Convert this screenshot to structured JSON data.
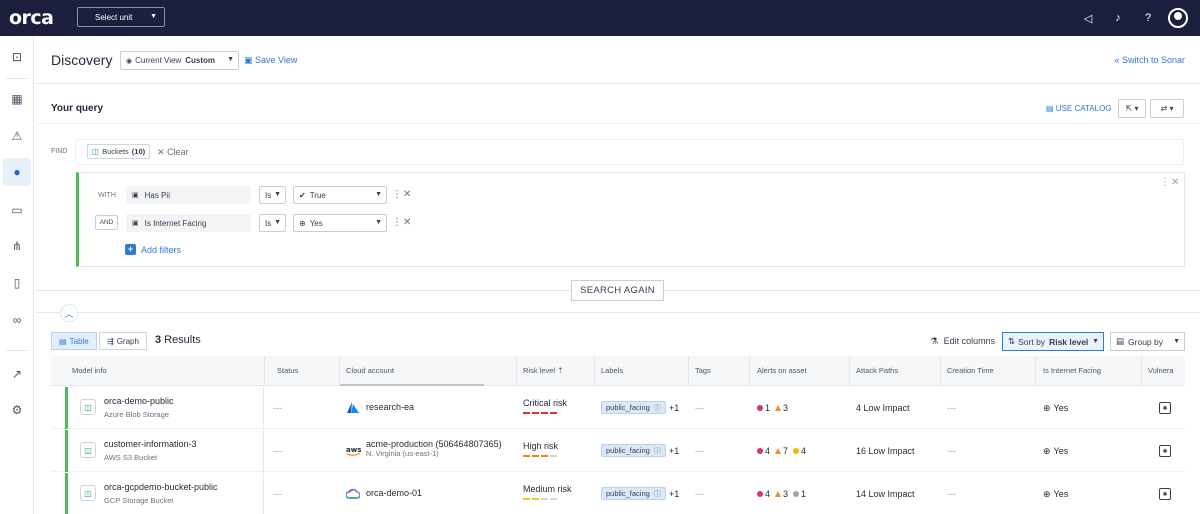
{
  "app": {
    "logo": "orca"
  },
  "topbar": {
    "unit_select": "Select unit"
  },
  "header": {
    "title": "Discovery",
    "view_label": "Current View",
    "view_value": "Custom",
    "save_view": "Save View",
    "switch_sonar": "Switch to Sonar"
  },
  "query": {
    "title": "Your query",
    "use_catalog": "USE CATALOG",
    "find_label": "FIND",
    "chip_label": "Buckets",
    "chip_count": "(10)",
    "clear": "Clear",
    "filters": [
      {
        "op": "WITH",
        "field": "Has Pii",
        "comparator": "Is",
        "value": "True",
        "value_icon": "check-icon"
      },
      {
        "op": "AND",
        "field": "Is Internet Facing",
        "comparator": "Is",
        "value": "Yes",
        "value_icon": "globe-icon"
      }
    ],
    "add_filters": "Add filters",
    "search_again": "SEARCH AGAIN"
  },
  "results": {
    "tabs": [
      {
        "label": "Table",
        "active": true
      },
      {
        "label": "Graph",
        "active": false
      }
    ],
    "count": "3",
    "count_label": "Results",
    "edit_columns": "Edit columns",
    "sort_by_label": "Sort by",
    "sort_by_value": "Risk level",
    "group_by": "Group by"
  },
  "table": {
    "columns": [
      "Model info",
      "Status",
      "Cloud account",
      "Risk level",
      "Labels",
      "Tags",
      "Alerts on asset",
      "Attack Paths",
      "Creation Time",
      "Is Internet Facing",
      "Vulnera"
    ],
    "rows": [
      {
        "name": "orca-demo-public",
        "type": "Azure Blob Storage",
        "status": "---",
        "cloud_icon": "azure-icon",
        "account": "research-ea",
        "region": "",
        "risk": "Critical risk",
        "risk_color": "#e03131",
        "risk_level": 4,
        "label": "public_facing",
        "label_more": "+1",
        "tags": "---",
        "alerts": [
          {
            "shape": "dot",
            "color": "#d6336c",
            "count": "1"
          },
          {
            "shape": "tri",
            "color": "#f28c28",
            "count": "3"
          }
        ],
        "attack_paths": "4 Low Impact",
        "creation": "---",
        "internet": "Yes"
      },
      {
        "name": "customer-information-3",
        "type": "AWS S3 Bucket",
        "status": "---",
        "cloud_icon": "aws-icon",
        "account": "acme-production (506464807365)",
        "region": "N. Virginia (us-east-1)",
        "risk": "High risk",
        "risk_color": "#f08c00",
        "risk_level": 3,
        "label": "public_facing",
        "label_more": "+1",
        "tags": "---",
        "alerts": [
          {
            "shape": "dot",
            "color": "#d6336c",
            "count": "4"
          },
          {
            "shape": "tri",
            "color": "#f28c28",
            "count": "7"
          },
          {
            "shape": "dot",
            "color": "#f5b800",
            "count": "4"
          }
        ],
        "attack_paths": "16 Low Impact",
        "creation": "---",
        "internet": "Yes"
      },
      {
        "name": "orca-gcpdemo-bucket-public",
        "type": "GCP Storage Bucket",
        "status": "---",
        "cloud_icon": "gcp-icon",
        "account": "orca-demo-01",
        "region": "",
        "risk": "Medium risk",
        "risk_color": "#f5c518",
        "risk_level": 2,
        "label": "public_facing",
        "label_more": "+1",
        "tags": "---",
        "alerts": [
          {
            "shape": "dot",
            "color": "#d6336c",
            "count": "4"
          },
          {
            "shape": "tri",
            "color": "#f28c28",
            "count": "3"
          },
          {
            "shape": "dot",
            "color": "#9ca3af",
            "count": "1"
          }
        ],
        "attack_paths": "14 Low Impact",
        "creation": "---",
        "internet": "Yes"
      }
    ]
  }
}
